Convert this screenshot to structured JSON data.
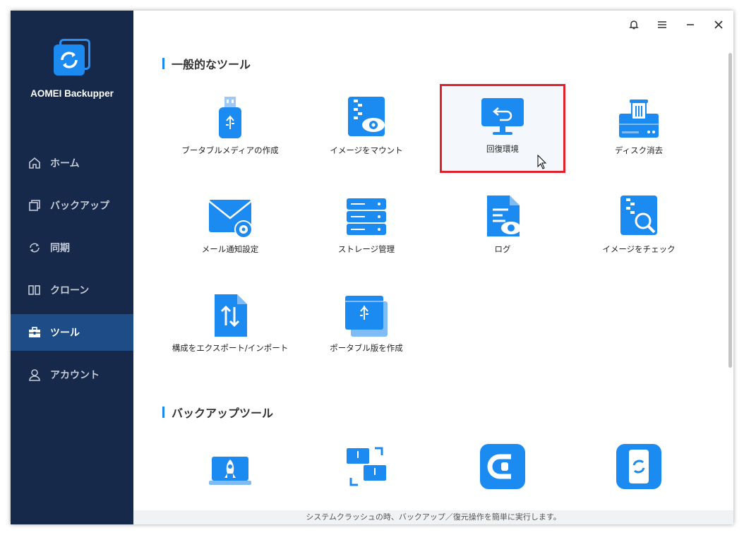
{
  "app": {
    "name": "AOMEI Backupper"
  },
  "sidebar": {
    "items": [
      {
        "label": "ホーム",
        "icon": "home-icon"
      },
      {
        "label": "バックアップ",
        "icon": "backup-icon"
      },
      {
        "label": "同期",
        "icon": "sync-icon"
      },
      {
        "label": "クローン",
        "icon": "clone-icon"
      },
      {
        "label": "ツール",
        "icon": "toolbox-icon",
        "active": true
      },
      {
        "label": "アカウント",
        "icon": "user-icon"
      }
    ]
  },
  "sections": {
    "general": {
      "title": "一般的なツール",
      "tools": [
        {
          "label": "ブータブルメディアの作成",
          "icon": "usb-drive-icon"
        },
        {
          "label": "イメージをマウント",
          "icon": "mount-image-icon"
        },
        {
          "label": "回復環境",
          "icon": "recovery-monitor-icon",
          "selected": true
        },
        {
          "label": "ディスク消去",
          "icon": "disk-wipe-icon"
        },
        {
          "label": "メール通知設定",
          "icon": "mail-settings-icon"
        },
        {
          "label": "ストレージ管理",
          "icon": "storage-icon"
        },
        {
          "label": "ログ",
          "icon": "log-icon"
        },
        {
          "label": "イメージをチェック",
          "icon": "check-image-icon"
        },
        {
          "label": "構成をエクスポート/インポート",
          "icon": "export-import-icon"
        },
        {
          "label": "ポータブル版を作成",
          "icon": "portable-icon"
        }
      ]
    },
    "backup": {
      "title": "バックアップツール",
      "tools": [
        {
          "icon": "rocket-laptop-icon"
        },
        {
          "icon": "pc-transfer-icon"
        },
        {
          "icon": "cbackupper-icon"
        },
        {
          "icon": "phone-sync-icon"
        }
      ]
    }
  },
  "status_bar": {
    "text": "システムクラッシュの時、バックアップ／復元操作を簡単に実行します。"
  },
  "colors": {
    "sidebar_bg": "#17294a",
    "active_nav": "#1d4c86",
    "accent": "#1c8bf1",
    "highlight_border": "#e0202a"
  }
}
